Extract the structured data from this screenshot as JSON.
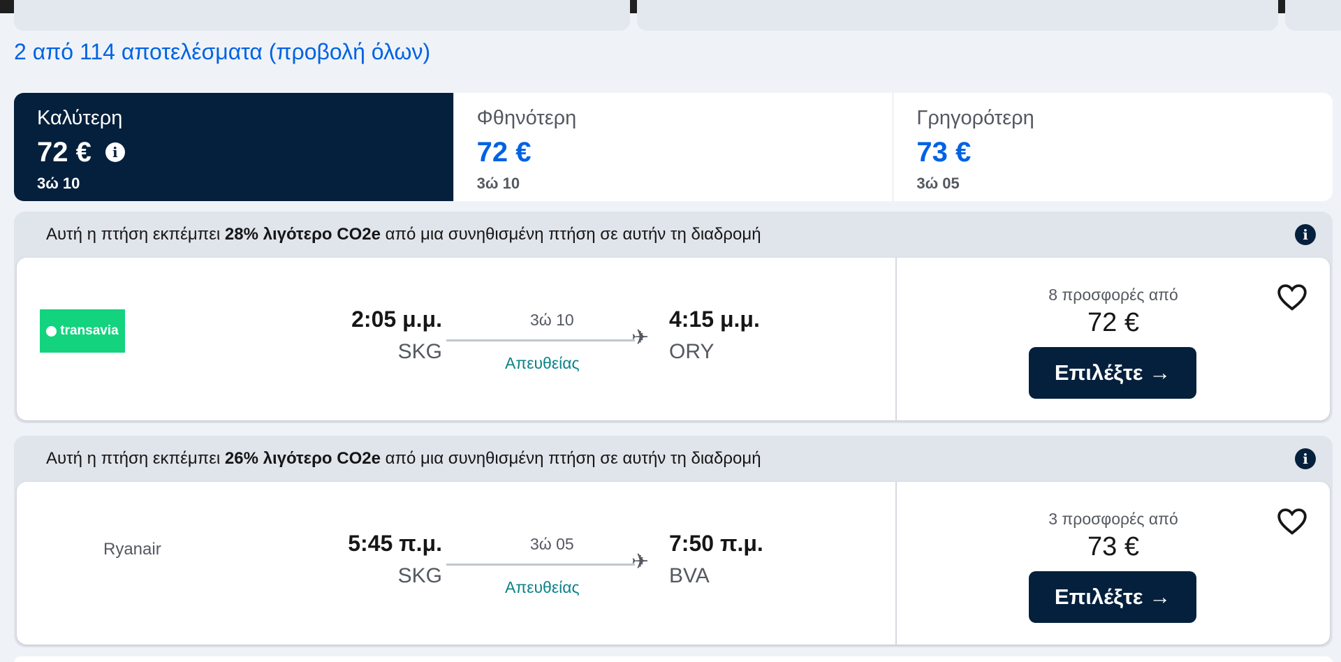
{
  "results": {
    "link_text": "2 από 114 αποτελέσματα (προβολή όλων)"
  },
  "sort_tabs": [
    {
      "label": "Καλύτερη",
      "price": "72 €",
      "duration": "3ώ 10",
      "active": true
    },
    {
      "label": "Φθηνότερη",
      "price": "72 €",
      "duration": "3ώ 10",
      "active": false
    },
    {
      "label": "Γρηγορότερη",
      "price": "73 €",
      "duration": "3ώ 05",
      "active": false
    }
  ],
  "flights": [
    {
      "eco_prefix": "Αυτή η πτήση εκπέμπει ",
      "eco_bold": "28% λιγότερο CO2e",
      "eco_suffix": " από μια συνηθισμένη πτήση σε αυτήν τη διαδρομή",
      "airline": "transavia",
      "dep_time": "2:05 μ.μ.",
      "dep_code": "SKG",
      "duration": "3ώ 10",
      "stops": "Απευθείας",
      "arr_time": "4:15 μ.μ.",
      "arr_code": "ORY",
      "deals": "8 προσφορές από",
      "price": "72 €",
      "select_label": "Επιλέξτε →"
    },
    {
      "eco_prefix": "Αυτή η πτήση εκπέμπει ",
      "eco_bold": "26% λιγότερο CO2e",
      "eco_suffix": " από μια συνηθισμένη πτήση σε αυτήν τη διαδρομή",
      "airline": "Ryanair",
      "dep_time": "5:45 π.μ.",
      "dep_code": "SKG",
      "duration": "3ώ 05",
      "stops": "Απευθείας",
      "arr_time": "7:50 π.μ.",
      "arr_code": "BVA",
      "deals": "3 προσφορές από",
      "price": "73 €",
      "select_label": "Επιλέξτε →"
    }
  ],
  "icons": {
    "info": "info-icon",
    "heart": "heart-icon",
    "plane": "plane-icon",
    "arrow": "arrow-right-icon"
  },
  "colors": {
    "navy": "#05203c",
    "link_blue": "#0062e3",
    "teal": "#0c838a",
    "transavia_green": "#13d37f",
    "background": "#eff3f8"
  }
}
